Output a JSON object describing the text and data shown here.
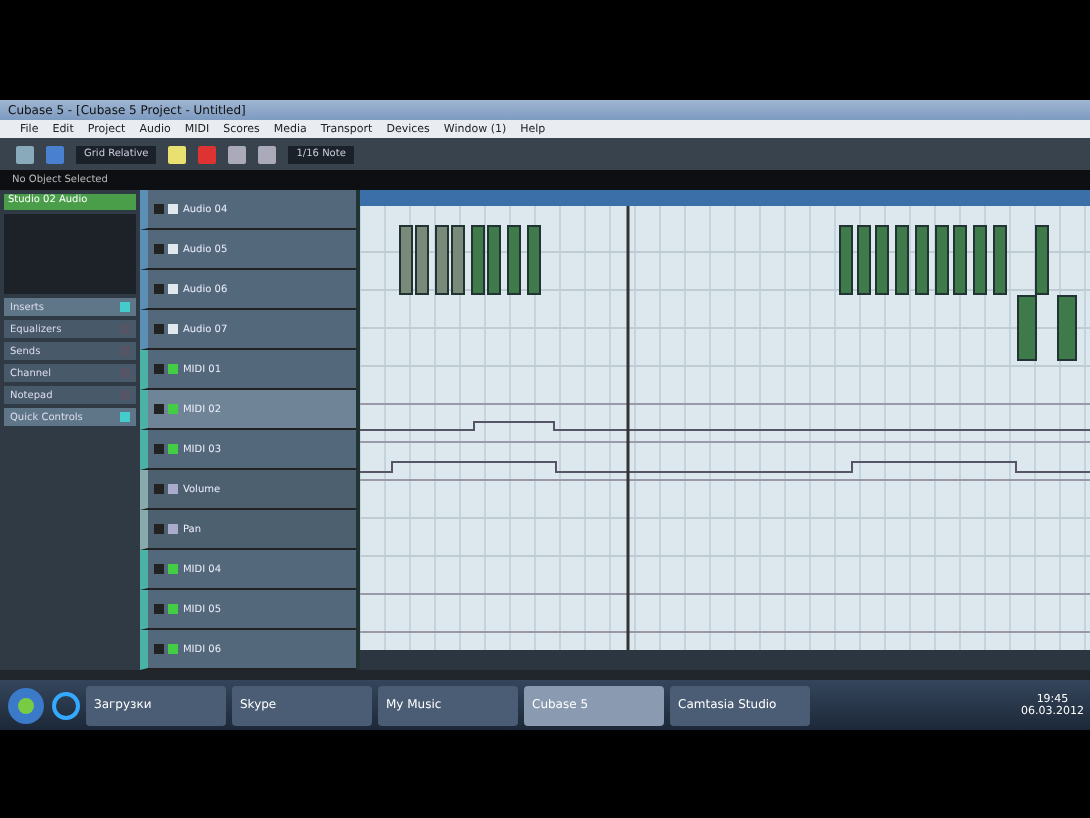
{
  "window": {
    "title": "Cubase 5 - [Cubase 5 Project - Untitled]"
  },
  "menu": [
    "File",
    "Edit",
    "Project",
    "Audio",
    "MIDI",
    "Scores",
    "Media",
    "Transport",
    "Devices",
    "Window (1)",
    "Help"
  ],
  "toolbar": {
    "mode": "Grid Relative",
    "quantize": "1/16 Note"
  },
  "info_line": "No Object Selected",
  "inspector": {
    "track": "Studio 02 Audio",
    "sections": [
      {
        "label": "Inserts",
        "expanded": true
      },
      {
        "label": "Equalizers",
        "expanded": false
      },
      {
        "label": "Sends",
        "expanded": false
      },
      {
        "label": "Channel",
        "expanded": false
      },
      {
        "label": "Notepad",
        "expanded": false
      },
      {
        "label": "Quick Controls",
        "expanded": true
      }
    ]
  },
  "tracks": [
    {
      "kind": "audio",
      "name": "Audio 04",
      "selected": false
    },
    {
      "kind": "audio",
      "name": "Audio 05",
      "selected": false
    },
    {
      "kind": "audio",
      "name": "Audio 06",
      "selected": false
    },
    {
      "kind": "audio",
      "name": "Audio 07",
      "selected": false
    },
    {
      "kind": "midi",
      "name": "MIDI 01",
      "selected": false
    },
    {
      "kind": "midi",
      "name": "MIDI 02",
      "selected": true
    },
    {
      "kind": "midi",
      "name": "MIDI 03",
      "selected": false
    },
    {
      "kind": "automation",
      "name": "Volume",
      "selected": false
    },
    {
      "kind": "automation",
      "name": "Pan",
      "selected": false
    },
    {
      "kind": "midi",
      "name": "MIDI 04",
      "selected": false
    },
    {
      "kind": "midi",
      "name": "MIDI 05",
      "selected": false
    },
    {
      "kind": "midi",
      "name": "MIDI 06",
      "selected": false
    }
  ],
  "taskbar": {
    "buttons": [
      {
        "label": "Загрузки",
        "selected": false
      },
      {
        "label": "Skype",
        "selected": false
      },
      {
        "label": "My Music",
        "selected": false
      },
      {
        "label": "Cubase 5",
        "selected": true
      },
      {
        "label": "Camtasia Studio",
        "selected": false
      }
    ],
    "time": "19:45",
    "date": "06.03.2012"
  }
}
